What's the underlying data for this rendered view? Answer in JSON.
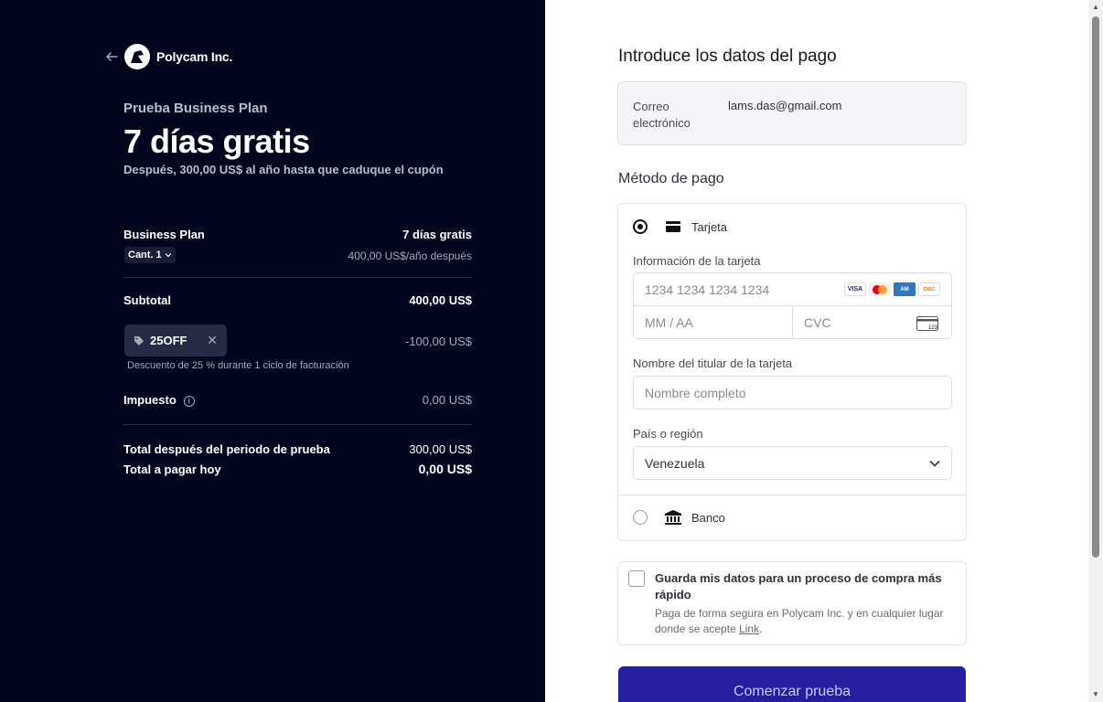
{
  "merchant": {
    "name": "Polycam Inc."
  },
  "summary": {
    "plan_trial_label": "Prueba Business Plan",
    "headline": "7 días gratis",
    "after_note": "Después, 300,00 US$ al año hasta que caduque el cupón",
    "line_item": {
      "name": "Business Plan",
      "price": "7 días gratis",
      "qty_label": "Cant. 1",
      "after_price": "400,00 US$/año después"
    },
    "subtotal_label": "Subtotal",
    "subtotal_value": "400,00 US$",
    "coupon": {
      "code": "25OFF",
      "discount": "-100,00 US$",
      "description": "Descuento de 25 % durante 1 ciclo de facturación"
    },
    "tax_label": "Impuesto",
    "tax_value": "0,00 US$",
    "total_after_trial_label": "Total después del periodo de prueba",
    "total_after_trial_value": "300,00 US$",
    "total_today_label": "Total a pagar hoy",
    "total_today_value": "0,00 US$"
  },
  "payment": {
    "title": "Introduce los datos del pago",
    "email_label": "Correo electrónico",
    "email_value": "lams.das@gmail.com",
    "method_title": "Método de pago",
    "card_option_label": "Tarjeta",
    "card_info_label": "Información de la tarjeta",
    "card_number_placeholder": "1234 1234 1234 1234",
    "expiry_placeholder": "MM / AA",
    "cvc_placeholder": "CVC",
    "cvc_badge": "123",
    "card_brands": [
      "VISA",
      "MC",
      "AMEX",
      "DISCOVER"
    ],
    "holder_label": "Nombre del titular de la tarjeta",
    "holder_placeholder": "Nombre completo",
    "country_label": "País o región",
    "country_value": "Venezuela",
    "bank_option_label": "Banco",
    "card_selected": true
  },
  "save_info": {
    "title": "Guarda mis datos para un proceso de compra más rápido",
    "description": "Paga de forma segura en Polycam Inc. y en cualquier lugar donde se acepte",
    "link": "Link",
    "period": "."
  },
  "cta_label": "Comenzar prueba",
  "colors": {
    "left_bg": "#03051e",
    "cta_bg": "#231f9e"
  }
}
